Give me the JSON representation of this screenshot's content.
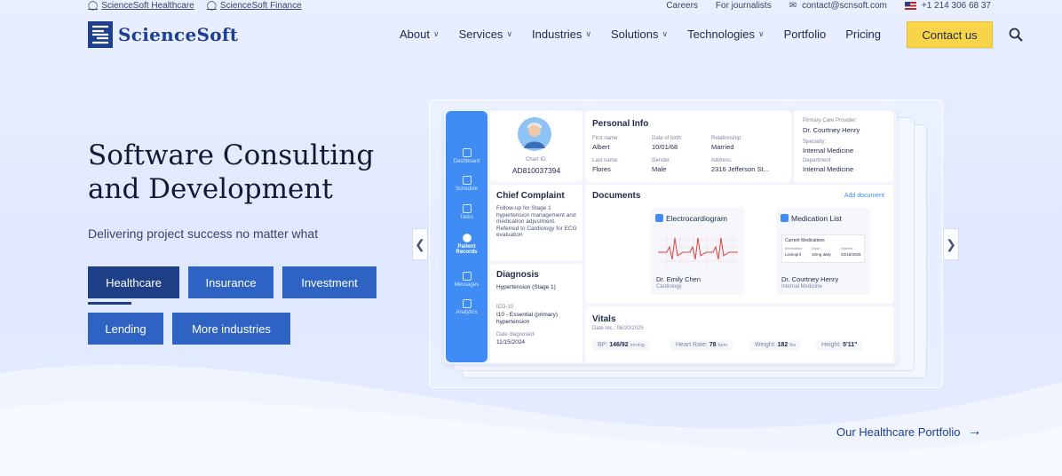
{
  "topbar": {
    "links": [
      "ScienceSoft Healthcare",
      "ScienceSoft Finance"
    ],
    "careers": "Careers",
    "journalists": "For journalists",
    "email": "contact@scnsoft.com",
    "phone": "+1 214 306 68 37"
  },
  "header": {
    "logo_text": "ScienceSoft",
    "nav": [
      "About",
      "Services",
      "Industries",
      "Solutions",
      "Technologies",
      "Portfolio",
      "Pricing"
    ],
    "contact_label": "Contact us"
  },
  "hero": {
    "title": "Software Consulting and Development",
    "subtitle": "Delivering project success no matter what",
    "industries": [
      "Healthcare",
      "Insurance",
      "Investment",
      "Lending",
      "More industries"
    ],
    "active_industry": "Healthcare",
    "portfolio_link": "Our Healthcare Portfolio"
  },
  "mockup": {
    "sidebar": [
      "Dashboard",
      "Schedule",
      "Tasks",
      "Patient Records",
      "Messages",
      "Analytics"
    ],
    "active_sidebar": "Patient Records",
    "patient": {
      "chart_label": "Chart ID:",
      "chart_id": "AD810037394"
    },
    "personal_info": {
      "title": "Personal Info",
      "first_name_label": "First name:",
      "first_name": "Albert",
      "dob_label": "Date of birth:",
      "dob": "10/01/68",
      "relationship_label": "Relationship:",
      "relationship": "Married",
      "last_name_label": "Last name:",
      "last_name": "Flores",
      "gender_label": "Gender:",
      "gender": "Male",
      "address_label": "Address:",
      "address": "2316 Jefferson St..."
    },
    "provider": {
      "pcp_label": "Primary Care Provider:",
      "pcp": "Dr. Courtney Henry",
      "specialty_label": "Specialty:",
      "specialty": "Internal Medicine",
      "department_label": "Department:",
      "department": "Internal Medicine"
    },
    "chief_complaint": {
      "title": "Chief Complaint",
      "text": "Follow-up for Stage 1 hypertension management and medication adjustment. Referred to Cardiology for ECG evaluation"
    },
    "documents": {
      "title": "Documents",
      "add_label": "Add document",
      "ecg_title": "Electrocardiogram",
      "ecg_doctor": "Dr. Emily Chen",
      "ecg_dept": "Cardiology",
      "med_title": "Medication List",
      "med_sub": "Current Medications",
      "med_cols": [
        "Medication",
        "Dose",
        "Started"
      ],
      "med_row": [
        "Lisinopril",
        "10mg daily",
        "02/15/2025"
      ],
      "med_doctor": "Dr. Courtney Henry",
      "med_dept": "Internal Medicine"
    },
    "diagnosis": {
      "title": "Diagnosis",
      "condition": "Hypertension (Stage 1)",
      "icd_label": "ICD-10",
      "icd": "I10 - Essential (primary) hypertension",
      "date_label": "Date diagnosed:",
      "date": "11/15/2024"
    },
    "vitals": {
      "title": "Vitals",
      "date": "Date rec.: 06/20/2025",
      "bp_label": "BP:",
      "bp": "146/92",
      "bp_unit": "mmHg",
      "hr_label": "Heart Rate:",
      "hr": "78",
      "hr_unit": "bpm",
      "weight_label": "Weight:",
      "weight": "182",
      "weight_unit": "lbs",
      "height_label": "Height:",
      "height": "5'11\""
    }
  },
  "colors": {
    "brand_blue": "#1d3f8f",
    "button_blue": "#2f63c3",
    "button_active": "#1d3f86",
    "contact_yellow": "#f7d449",
    "sidebar_blue": "#3e8cf4"
  }
}
